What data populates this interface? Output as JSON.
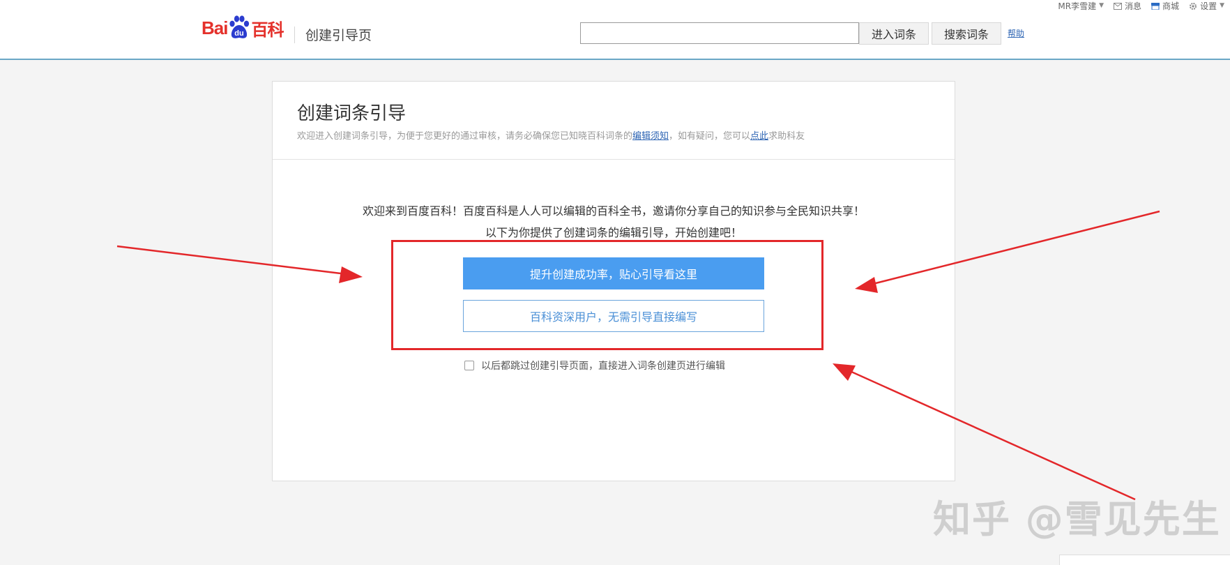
{
  "header": {
    "logo_latin": "Bai",
    "logo_paw_text": "du",
    "logo_cn": "百科",
    "page_subtitle": "创建引导页",
    "search_value": "",
    "enter_label": "进入词条",
    "search_label": "搜索词条",
    "help_label": "帮助"
  },
  "topbar": {
    "user": "MR李雪建",
    "messages": "消息",
    "mall": "商城",
    "settings": "设置"
  },
  "card": {
    "title": "创建词条引导",
    "desc_before": "欢迎进入创建词条引导，为便于您更好的通过审核，请务必确保您已知晓百科词条的",
    "desc_link1": "编辑须知",
    "desc_middle": "，如有疑问，您可以",
    "desc_link2": "点此",
    "desc_after": "求助科友",
    "welcome_line1": "欢迎来到百度百科！百度百科是人人可以编辑的百科全书，邀请你分享自己的知识参与全民知识共享！",
    "welcome_line2": "以下为你提供了创建词条的编辑引导，开始创建吧！",
    "primary_btn": "提升创建成功率，贴心引导看这里",
    "secondary_btn": "百科资深用户，无需引导直接编写",
    "skip_label": "以后都跳过创建引导页面，直接进入词条创建页进行编辑"
  },
  "watermark": "知乎 @雪见先生",
  "colors": {
    "brand_red": "#e4312b",
    "paw_blue": "#2b3ccf",
    "primary_blue": "#4a9df0",
    "annotation_red": "#e3272a"
  }
}
